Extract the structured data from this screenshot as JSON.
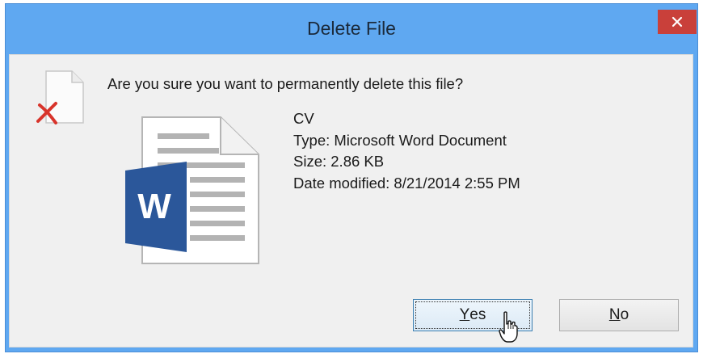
{
  "window": {
    "title": "Delete File"
  },
  "dialog": {
    "question": "Are you sure you want to permanently delete this file?",
    "file": {
      "name": "CV",
      "type": "Type: Microsoft Word Document",
      "size": "Size: 2.86 KB",
      "date_modified": "Date modified: 8/21/2014 2:55 PM"
    },
    "word_icon_letter": "W"
  },
  "buttons": {
    "yes": {
      "mnemonic": "Y",
      "rest": "es"
    },
    "no": {
      "mnemonic": "N",
      "rest": "o"
    }
  },
  "icons": {
    "close": "close-icon",
    "delete_file": "delete-file-icon",
    "word_document": "word-document-icon",
    "cursor": "mouse-cursor-icon"
  },
  "colors": {
    "titlebar": "#5fa8f1",
    "close_button": "#c9403a",
    "dialog_background": "#f0f0f0",
    "word_blue": "#2b579a",
    "delete_red": "#d8342b"
  }
}
